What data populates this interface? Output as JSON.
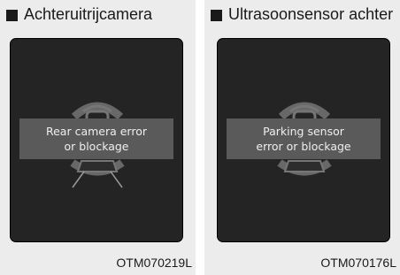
{
  "panels": [
    {
      "title": "Achteruitrijcamera",
      "message_line1": "Rear camera error",
      "message_line2": "or blockage",
      "code": "OTM070219L"
    },
    {
      "title": "Ultrasoonsensor achter",
      "message_line1": "Parking sensor",
      "message_line2": "error or blockage",
      "code": "OTM070176L"
    }
  ],
  "icons": {
    "title_bullet": "black-square-icon",
    "display_graphic": "rear-car-sensor-icon"
  },
  "colors": {
    "screen_background": "#242424",
    "banner_background": "#5a5a5a",
    "sensor_arc": "#666666",
    "panel_background": "#ececed"
  }
}
